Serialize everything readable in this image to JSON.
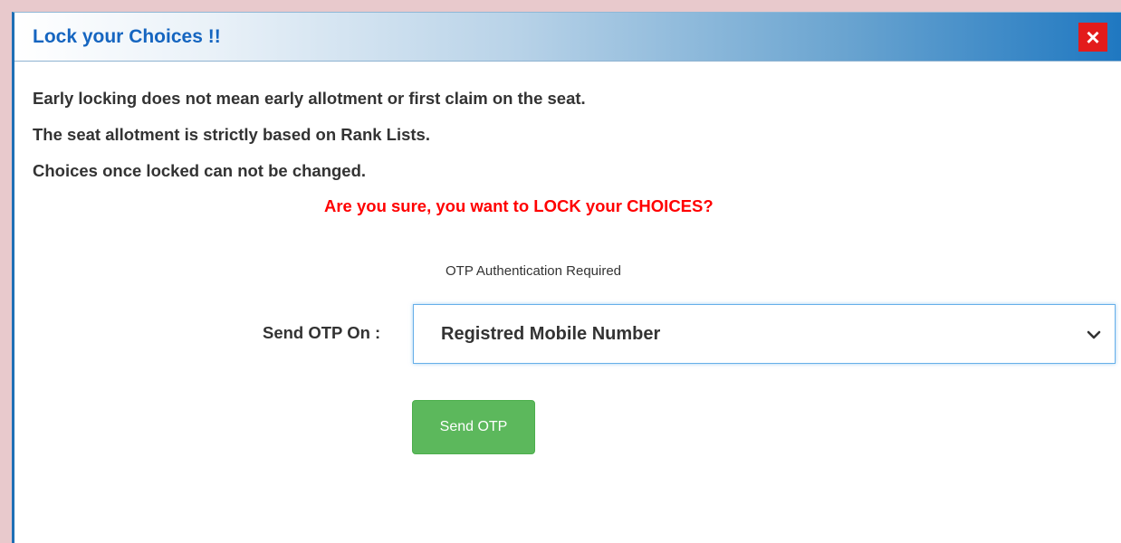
{
  "dialog": {
    "title": "Lock your Choices !!",
    "close_label": "×",
    "messages": [
      "Early locking does not mean early allotment or first claim on the seat.",
      "The seat allotment is strictly based on Rank Lists.",
      "Choices once locked can not be changed."
    ],
    "warning": "Are you sure, you want to LOCK your CHOICES?",
    "otp_required": "OTP Authentication Required",
    "send_otp_on_label": "Send OTP On :",
    "send_otp_select_value": "Registred Mobile Number",
    "send_otp_button": "Send OTP"
  },
  "colors": {
    "title": "#1565c0",
    "close_bg": "#e31b1b",
    "warning": "#ff0000",
    "button_bg": "#5cb85c",
    "body_text": "#333333"
  },
  "icons": {
    "close": "close-icon",
    "select_arrow": "chevron-down-icon"
  }
}
